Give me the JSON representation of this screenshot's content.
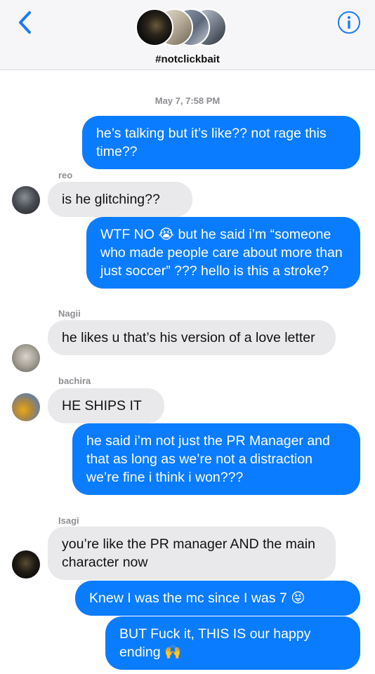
{
  "header": {
    "group_name": "#notclickbait",
    "back_icon": "chevron-left-icon",
    "info_icon": "info-icon",
    "accent_color": "#1a7cf5"
  },
  "conversation": {
    "timestamp": "May 7, 7:58 PM",
    "messages": [
      {
        "from": "me",
        "text": "he’s talking but it’s like?? not rage this time??"
      },
      {
        "from": "reo",
        "sender_label": "reo",
        "text": "is he glitching??"
      },
      {
        "from": "me",
        "text": "WTF NO 😭 but he said i’m “someone who made people care about more than just soccer” ??? hello is this a stroke?"
      },
      {
        "from": "Nagii",
        "sender_label": "Nagii",
        "text": "he likes u that’s his version of a love letter"
      },
      {
        "from": "bachira",
        "sender_label": "bachira",
        "text": "HE SHIPS IT"
      },
      {
        "from": "me",
        "text": "he said i’m not just the PR Manager and that as long as we’re not a distraction we’re fine i think i won???"
      },
      {
        "from": "Isagi",
        "sender_label": "Isagi",
        "text": "you’re like the PR manager AND the main character now"
      },
      {
        "from": "me",
        "text": "Knew I was the mc since I was 7 😝"
      },
      {
        "from": "me",
        "text": "BUT Fuck it, THIS IS our happy ending 🙌"
      }
    ]
  },
  "colors": {
    "outgoing_bubble": "#0a7cff",
    "incoming_bubble": "#e9e9eb",
    "meta_text": "#8e8e93"
  }
}
